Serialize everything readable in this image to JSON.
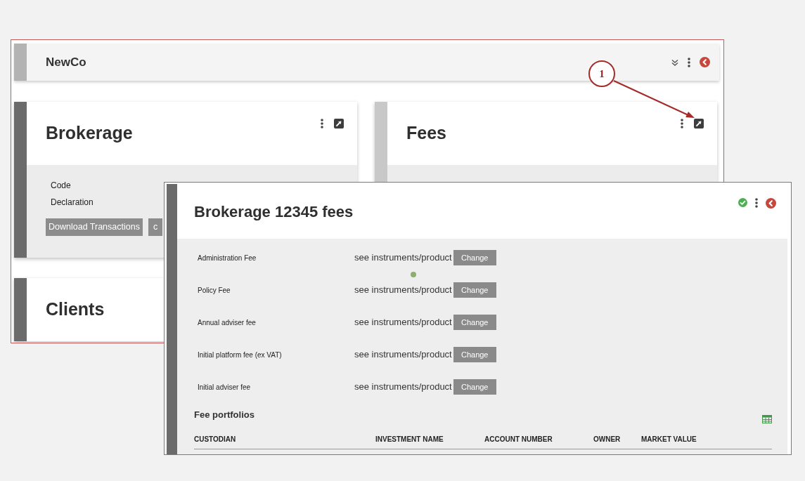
{
  "background_window": {
    "header": {
      "title": "NewCo"
    },
    "cards": [
      {
        "title": "Brokerage",
        "color": "#6b6b6b",
        "fields": [
          "Code",
          "Declaration"
        ],
        "buttons": [
          "Download Transactions",
          "c"
        ]
      },
      {
        "title": "Fees",
        "color": "#c8c8c8"
      },
      {
        "title": "Clients",
        "color": "#6b6b6b"
      }
    ]
  },
  "callout": {
    "label": "1"
  },
  "fees_window": {
    "title": "Brokerage 12345 fees",
    "fees": [
      {
        "label": "Administration Fee",
        "value": "see instruments/product",
        "button": "Change"
      },
      {
        "label": "Policy Fee",
        "value": "see instruments/product",
        "button": "Change"
      },
      {
        "label": "Annual adviser fee",
        "value": "see instruments/product",
        "button": "Change"
      },
      {
        "label": "Initial platform fee (ex VAT)",
        "value": "see instruments/product",
        "button": "Change"
      },
      {
        "label": "Initial adviser fee",
        "value": "see instruments/product",
        "button": "Change"
      }
    ],
    "fee_portfolios": {
      "title": "Fee portfolios",
      "columns": [
        "CUSTODIAN",
        "INVESTMENT NAME",
        "ACCOUNT NUMBER",
        "OWNER",
        "MARKET VALUE"
      ]
    }
  }
}
